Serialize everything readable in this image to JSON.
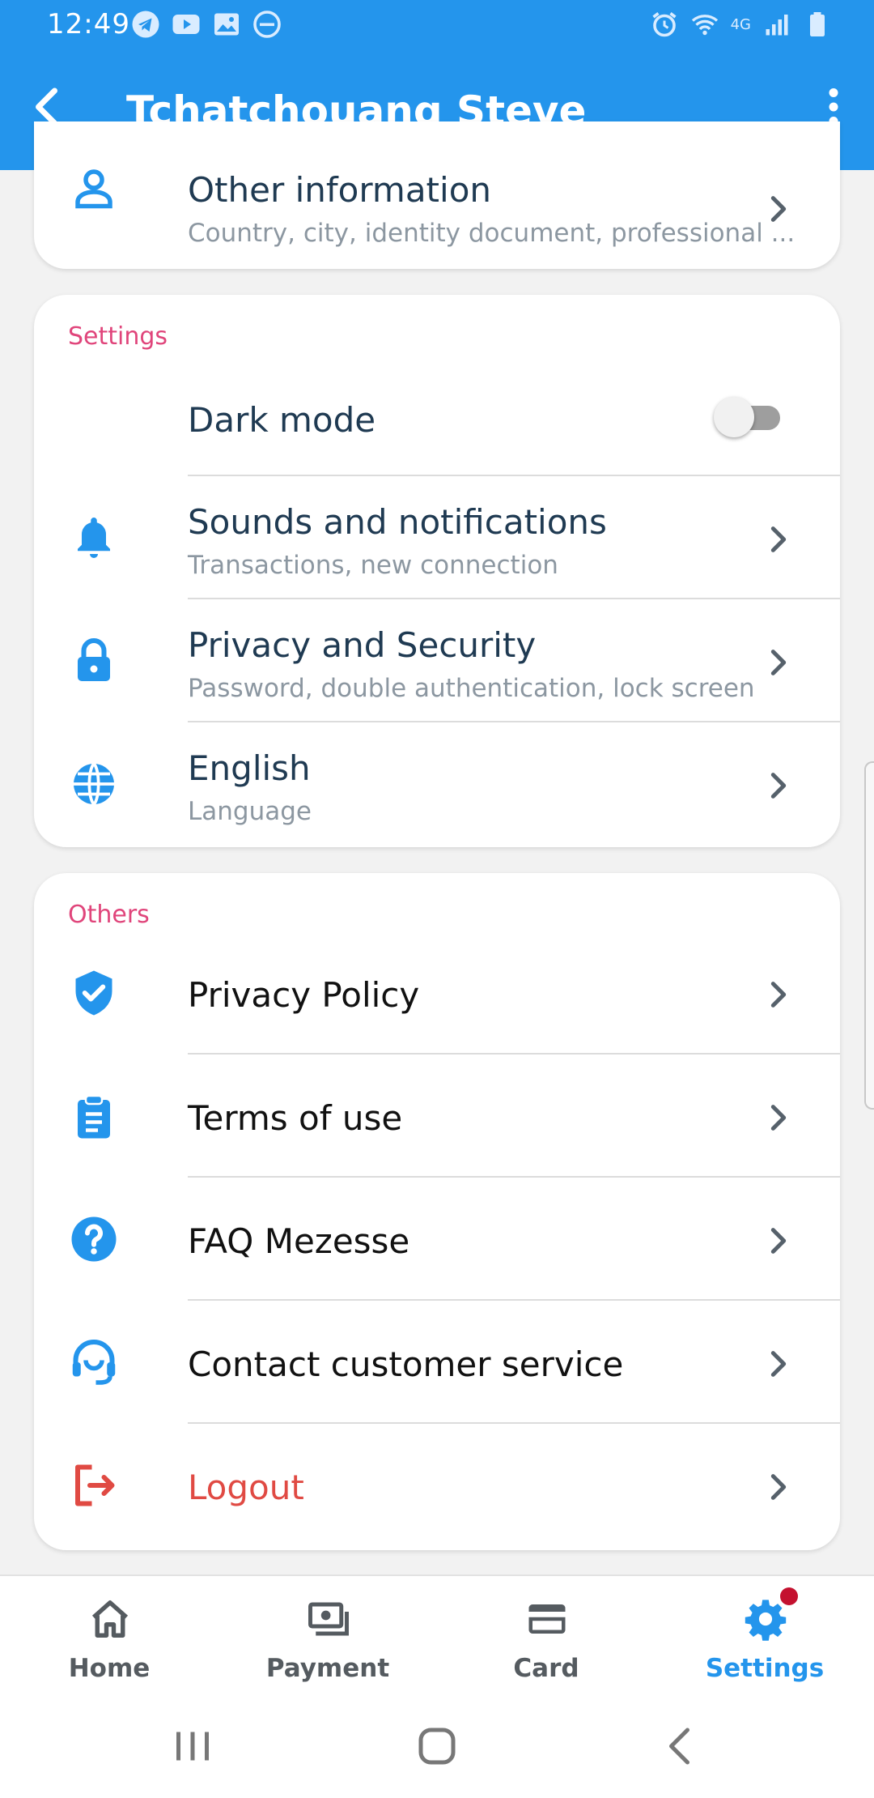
{
  "status_bar": {
    "time": "12:49",
    "network": "4G",
    "left_icons": [
      "telegram-icon",
      "youtube-icon",
      "gallery-icon",
      "do-not-disturb-icon"
    ],
    "right_icons": [
      "alarm-icon",
      "wifi-icon",
      "signal-icon",
      "battery-icon"
    ]
  },
  "header": {
    "title": "Tchatchouang Steve",
    "background": "#2495ec"
  },
  "top_card": {
    "title": "Other information",
    "subtitle": "Country, city, identity document, professional ..."
  },
  "settings": {
    "section_title": "Settings",
    "dark_mode_label": "Dark mode",
    "dark_mode_on": false,
    "items": [
      {
        "title": "Sounds and notifications",
        "subtitle": "Transactions, new connection",
        "icon": "bell-icon"
      },
      {
        "title": "Privacy and Security",
        "subtitle": "Password, double authentication, lock screen",
        "icon": "lock-icon"
      },
      {
        "title": "English",
        "subtitle": "Language",
        "icon": "globe-icon"
      }
    ]
  },
  "others": {
    "section_title": "Others",
    "items": [
      {
        "title": "Privacy Policy",
        "icon": "shield-check-icon"
      },
      {
        "title": "Terms of use",
        "icon": "clipboard-icon"
      },
      {
        "title": "FAQ Mezesse",
        "icon": "help-circle-icon"
      },
      {
        "title": "Contact customer service",
        "icon": "headset-icon"
      },
      {
        "title": "Logout",
        "icon": "logout-icon"
      }
    ]
  },
  "bottom_nav": {
    "items": [
      {
        "label": "Home",
        "icon": "home-icon"
      },
      {
        "label": "Payment",
        "icon": "payment-icon"
      },
      {
        "label": "Card",
        "icon": "card-icon"
      },
      {
        "label": "Settings",
        "icon": "settings-icon",
        "active": true
      }
    ]
  },
  "colors": {
    "accent": "#2495ec",
    "section_title": "#e0457b",
    "logout": "#e04a43",
    "badge": "#c4112f"
  }
}
